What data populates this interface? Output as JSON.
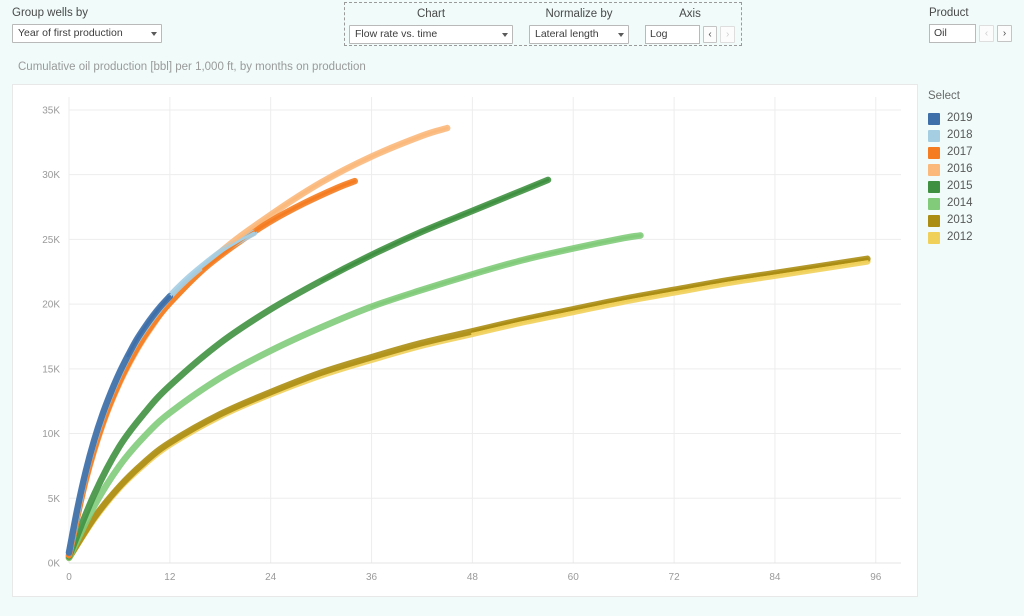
{
  "toolbar": {
    "group_wells_by": {
      "label": "Group wells by",
      "value": "Year of first production"
    },
    "chart": {
      "label": "Chart",
      "value": "Flow rate vs. time"
    },
    "normalize_by": {
      "label": "Normalize by",
      "value": "Lateral length"
    },
    "axis": {
      "label": "Axis",
      "value": "Log",
      "prev_arrow": "‹",
      "next_arrow": "›"
    },
    "product": {
      "label": "Product",
      "value": "Oil",
      "prev_arrow": "‹",
      "next_arrow": "›"
    }
  },
  "chart_title": "Cumulative oil production [bbl] per 1,000 ft, by months on production",
  "legend": {
    "title": "Select",
    "items": [
      {
        "label": "2019",
        "color": "#3f6fa8"
      },
      {
        "label": "2018",
        "color": "#a6cee3"
      },
      {
        "label": "2017",
        "color": "#f57c20"
      },
      {
        "label": "2016",
        "color": "#fbb97c"
      },
      {
        "label": "2015",
        "color": "#3f9141"
      },
      {
        "label": "2014",
        "color": "#81cb7a"
      },
      {
        "label": "2013",
        "color": "#ab8d14"
      },
      {
        "label": "2012",
        "color": "#f1d05a"
      }
    ]
  },
  "chart_data": {
    "type": "line",
    "title": "Cumulative oil production [bbl] per 1,000 ft, by months on production",
    "xlabel": "Months on production",
    "ylabel": "Cumulative oil production [bbl] per 1,000 ft",
    "xlim": [
      0,
      99
    ],
    "ylim": [
      0,
      36000
    ],
    "xticks": [
      0,
      12,
      24,
      36,
      48,
      60,
      72,
      84,
      96
    ],
    "xticklabels": [
      "0",
      "12",
      "24",
      "36",
      "48",
      "60",
      "72",
      "84",
      "96"
    ],
    "yticks": [
      0,
      5000,
      10000,
      15000,
      20000,
      25000,
      30000,
      35000
    ],
    "yticklabels": [
      "0K",
      "5K",
      "10K",
      "15K",
      "20K",
      "25K",
      "30K",
      "35K"
    ],
    "grid": true,
    "legend_position": "right",
    "series": [
      {
        "name": "2019",
        "color": "#3f6fa8",
        "x": [
          0,
          1,
          2,
          3,
          4,
          5,
          6,
          7,
          8,
          9,
          10,
          11,
          12
        ],
        "y": [
          800,
          4200,
          7100,
          9500,
          11500,
          13200,
          14700,
          16000,
          17200,
          18200,
          19100,
          19900,
          20600
        ]
      },
      {
        "name": "2018",
        "color": "#a6cee3",
        "x": [
          0,
          2,
          4,
          6,
          8,
          10,
          12,
          14,
          16,
          18,
          20,
          22
        ],
        "y": [
          800,
          7000,
          11400,
          14600,
          17100,
          19000,
          20600,
          21900,
          23000,
          24000,
          24800,
          25500
        ]
      },
      {
        "name": "2017",
        "color": "#f57c20",
        "x": [
          0,
          2,
          4,
          6,
          8,
          10,
          12,
          16,
          20,
          24,
          28,
          32,
          34
        ],
        "y": [
          600,
          6500,
          10800,
          14000,
          16500,
          18500,
          20100,
          22700,
          24700,
          26400,
          27800,
          29000,
          29500
        ]
      },
      {
        "name": "2016",
        "color": "#fbb97c",
        "x": [
          0,
          2,
          4,
          6,
          8,
          10,
          12,
          18,
          24,
          30,
          36,
          42,
          45
        ],
        "y": [
          600,
          6400,
          10700,
          13900,
          16400,
          18400,
          20100,
          24000,
          26900,
          29400,
          31400,
          33000,
          33600
        ]
      },
      {
        "name": "2015",
        "color": "#3f9141",
        "x": [
          0,
          3,
          6,
          9,
          12,
          18,
          24,
          30,
          36,
          42,
          48,
          54,
          57
        ],
        "y": [
          500,
          5300,
          9000,
          11600,
          13700,
          17000,
          19600,
          21800,
          23800,
          25600,
          27200,
          28800,
          29600
        ]
      },
      {
        "name": "2014",
        "color": "#81cb7a",
        "x": [
          0,
          3,
          6,
          9,
          12,
          18,
          24,
          30,
          36,
          42,
          48,
          54,
          60,
          66,
          68
        ],
        "y": [
          400,
          4400,
          7500,
          9800,
          11600,
          14300,
          16400,
          18200,
          19800,
          21100,
          22300,
          23400,
          24300,
          25100,
          25300
        ]
      },
      {
        "name": "2013",
        "color": "#ab8d14",
        "x": [
          0,
          3,
          6,
          9,
          12,
          18,
          24,
          30,
          36,
          42,
          48,
          54,
          60,
          66,
          72,
          78,
          84,
          90,
          95
        ],
        "y": [
          400,
          3500,
          5900,
          7800,
          9300,
          11500,
          13200,
          14700,
          15900,
          17000,
          17900,
          18800,
          19600,
          20400,
          21100,
          21800,
          22400,
          23000,
          23500
        ]
      },
      {
        "name": "2012",
        "color": "#f1d05a",
        "x": [
          0,
          3,
          6,
          9,
          12,
          18,
          24,
          30,
          36,
          42,
          48,
          54,
          60,
          66,
          72,
          78,
          84,
          90,
          95
        ],
        "y": [
          400,
          3400,
          5800,
          7650,
          9150,
          11350,
          13050,
          14500,
          15700,
          16800,
          17700,
          18600,
          19400,
          20200,
          20900,
          21600,
          22200,
          22800,
          23300
        ]
      }
    ]
  }
}
